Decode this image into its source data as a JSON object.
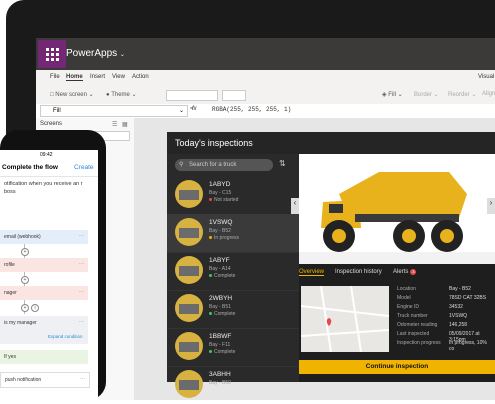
{
  "app": {
    "window_title": "PowerApps"
  },
  "menu": {
    "file": "File",
    "home": "Home",
    "insert": "Insert",
    "view": "View",
    "action": "Action",
    "visual": "Visual"
  },
  "toolbar": {
    "new_screen": "New screen",
    "theme": "Theme",
    "fill_btn": "Fill",
    "border": "Border",
    "reorder": "Reorder",
    "align": "Align"
  },
  "formula": {
    "property": "Fill",
    "fx": "fx",
    "value": "RGBA(255, 255, 255, 1)"
  },
  "screens_panel": {
    "title": "Screens",
    "search": "Search"
  },
  "inspection_app": {
    "title": "Today's inspections",
    "search_placeholder": "Search for a truck",
    "trucks": [
      {
        "id": "1ABYD",
        "bay": "Bay - C15",
        "status": "Not started",
        "status_color": "#e34b4b"
      },
      {
        "id": "1VSWQ",
        "bay": "Bay - B52",
        "status": "In progress",
        "status_color": "#f0b400"
      },
      {
        "id": "1ABYF",
        "bay": "Bay - A14",
        "status": "Complete",
        "status_color": "#3ec95f"
      },
      {
        "id": "2WBYH",
        "bay": "Bay - B51",
        "status": "Complete",
        "status_color": "#3ec95f"
      },
      {
        "id": "1BBWF",
        "bay": "Bay - F11",
        "status": "Complete",
        "status_color": "#3ec95f"
      },
      {
        "id": "3ABHH",
        "bay": "Bay - B50",
        "status": "",
        "status_color": "#3ec95f"
      }
    ],
    "tabs": {
      "overview": "Overview",
      "history": "Inspection history",
      "alerts": "Alerts",
      "alerts_count": "3"
    },
    "details": [
      {
        "label": "Location",
        "value": "Bay - B52"
      },
      {
        "label": "Model",
        "value": "78SD CAT 32BS"
      },
      {
        "label": "Engine ID",
        "value": "34532"
      },
      {
        "label": "Truck number",
        "value": "1VSWQ"
      },
      {
        "label": "Odometer reading",
        "value": "146,258"
      },
      {
        "label": "Last inspected",
        "value": "05/09/2017 at 3:15pm"
      },
      {
        "label": "Inspection progress",
        "value": "In progress, 10% co"
      }
    ],
    "continue_label": "Continue inspection",
    "accent": "#f0b400"
  },
  "phone": {
    "time": "09:42",
    "title": "Complete the flow",
    "create": "Create",
    "description": "otification when you receive an r boss",
    "steps": [
      {
        "label": "email (webhook)",
        "color": "#e4eefb"
      },
      {
        "label": "rofile",
        "color": "#fbe5e2"
      },
      {
        "label": "nager",
        "color": "#fbe5e2"
      },
      {
        "label": "is my manager",
        "color": "#eef0f3"
      },
      {
        "label": "push notification",
        "color": "#e9f4e3"
      }
    ],
    "expand_condition": "Expand condition",
    "if_yes": "If yes"
  }
}
